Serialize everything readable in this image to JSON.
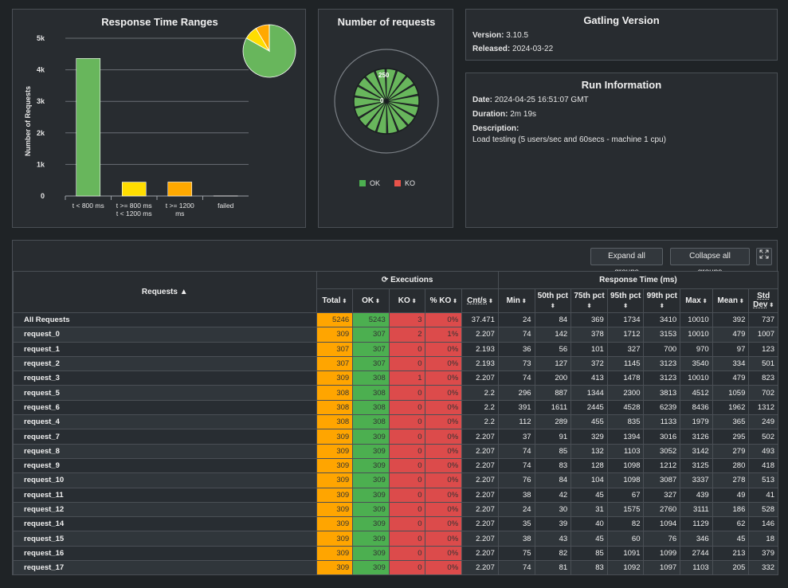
{
  "ranges": {
    "title": "Response Time Ranges",
    "ylabel": "Number of Requests",
    "ticks": [
      "0",
      "1k",
      "2k",
      "3k",
      "4k",
      "5k"
    ]
  },
  "nreq": {
    "title": "Number of requests",
    "label_250": "250",
    "label_0": "0",
    "legend_ok": "OK",
    "legend_ko": "KO",
    "spokes": 18
  },
  "version": {
    "title": "Gatling Version",
    "version_label": "Version:",
    "version_value": "3.10.5",
    "released_label": "Released:",
    "released_value": "2024-03-22"
  },
  "run": {
    "title": "Run Information",
    "date_label": "Date:",
    "date_value": "2024-04-25 16:51:07 GMT",
    "duration_label": "Duration:",
    "duration_value": "2m 19s",
    "description_label": "Description:",
    "description_value": "Load testing (5 users/sec and 60secs - machine 1 cpu)"
  },
  "buttons": {
    "expand": "Expand all groups",
    "collapse": "Collapse all groups",
    "fullscreen_icon": "expand-arrows-icon"
  },
  "table": {
    "requests_header": "Requests ▲",
    "executions_header": "Executions",
    "response_header": "Response Time (ms)",
    "columns": [
      "Total",
      "OK",
      "KO",
      "% KO",
      "Cnt/s",
      "Min",
      "50th pct",
      "75th pct",
      "95th pct",
      "99th pct",
      "Max",
      "Mean",
      "Std Dev"
    ],
    "rows": [
      [
        "All Requests",
        "5246",
        "5243",
        "3",
        "0%",
        "37.471",
        "24",
        "84",
        "369",
        "1734",
        "3410",
        "10010",
        "392",
        "737"
      ],
      [
        "request_0",
        "309",
        "307",
        "2",
        "1%",
        "2.207",
        "74",
        "142",
        "378",
        "1712",
        "3153",
        "10010",
        "479",
        "1007"
      ],
      [
        "request_1",
        "307",
        "307",
        "0",
        "0%",
        "2.193",
        "36",
        "56",
        "101",
        "327",
        "700",
        "970",
        "97",
        "123"
      ],
      [
        "request_2",
        "307",
        "307",
        "0",
        "0%",
        "2.193",
        "73",
        "127",
        "372",
        "1145",
        "3123",
        "3540",
        "334",
        "501"
      ],
      [
        "request_3",
        "309",
        "308",
        "1",
        "0%",
        "2.207",
        "74",
        "200",
        "413",
        "1478",
        "3123",
        "10010",
        "479",
        "823"
      ],
      [
        "request_5",
        "308",
        "308",
        "0",
        "0%",
        "2.2",
        "296",
        "887",
        "1344",
        "2300",
        "3813",
        "4512",
        "1059",
        "702"
      ],
      [
        "request_6",
        "308",
        "308",
        "0",
        "0%",
        "2.2",
        "391",
        "1611",
        "2445",
        "4528",
        "6239",
        "8436",
        "1962",
        "1312"
      ],
      [
        "request_4",
        "308",
        "308",
        "0",
        "0%",
        "2.2",
        "112",
        "289",
        "455",
        "835",
        "1133",
        "1979",
        "365",
        "249"
      ],
      [
        "request_7",
        "309",
        "309",
        "0",
        "0%",
        "2.207",
        "37",
        "91",
        "329",
        "1394",
        "3016",
        "3126",
        "295",
        "502"
      ],
      [
        "request_8",
        "309",
        "309",
        "0",
        "0%",
        "2.207",
        "74",
        "85",
        "132",
        "1103",
        "3052",
        "3142",
        "279",
        "493"
      ],
      [
        "request_9",
        "309",
        "309",
        "0",
        "0%",
        "2.207",
        "74",
        "83",
        "128",
        "1098",
        "1212",
        "3125",
        "280",
        "418"
      ],
      [
        "request_10",
        "309",
        "309",
        "0",
        "0%",
        "2.207",
        "76",
        "84",
        "104",
        "1098",
        "3087",
        "3337",
        "278",
        "513"
      ],
      [
        "request_11",
        "309",
        "309",
        "0",
        "0%",
        "2.207",
        "38",
        "42",
        "45",
        "67",
        "327",
        "439",
        "49",
        "41"
      ],
      [
        "request_12",
        "309",
        "309",
        "0",
        "0%",
        "2.207",
        "24",
        "30",
        "31",
        "1575",
        "2760",
        "3111",
        "186",
        "528"
      ],
      [
        "request_14",
        "309",
        "309",
        "0",
        "0%",
        "2.207",
        "35",
        "39",
        "40",
        "82",
        "1094",
        "1129",
        "62",
        "146"
      ],
      [
        "request_15",
        "309",
        "309",
        "0",
        "0%",
        "2.207",
        "38",
        "43",
        "45",
        "60",
        "76",
        "346",
        "45",
        "18"
      ],
      [
        "request_16",
        "309",
        "309",
        "0",
        "0%",
        "2.207",
        "75",
        "82",
        "85",
        "1091",
        "1099",
        "2744",
        "213",
        "379"
      ],
      [
        "request_17",
        "309",
        "309",
        "0",
        "0%",
        "2.207",
        "74",
        "81",
        "83",
        "1092",
        "1097",
        "1103",
        "205",
        "332"
      ]
    ]
  },
  "chart_data": [
    {
      "type": "bar",
      "title": "Response Time Ranges",
      "ylabel": "Number of Requests",
      "categories": [
        "t < 800 ms",
        "t >= 800 ms t < 1200 ms",
        "t >= 1200 ms",
        "failed"
      ],
      "values": [
        4360,
        440,
        443,
        3
      ],
      "colors": [
        "#68b65c",
        "#ffdd00",
        "#ffa900",
        "#f15b4f"
      ],
      "ylim": [
        0,
        5000
      ],
      "grid": true
    },
    {
      "type": "pie",
      "categories": [
        "t < 800 ms",
        "t >= 800 ms t < 1200 ms",
        "t >= 1200 ms",
        "failed"
      ],
      "values": [
        4360,
        440,
        443,
        3
      ],
      "colors": [
        "#68b65c",
        "#ffdd00",
        "#ffa900",
        "#f15b4f"
      ]
    }
  ]
}
